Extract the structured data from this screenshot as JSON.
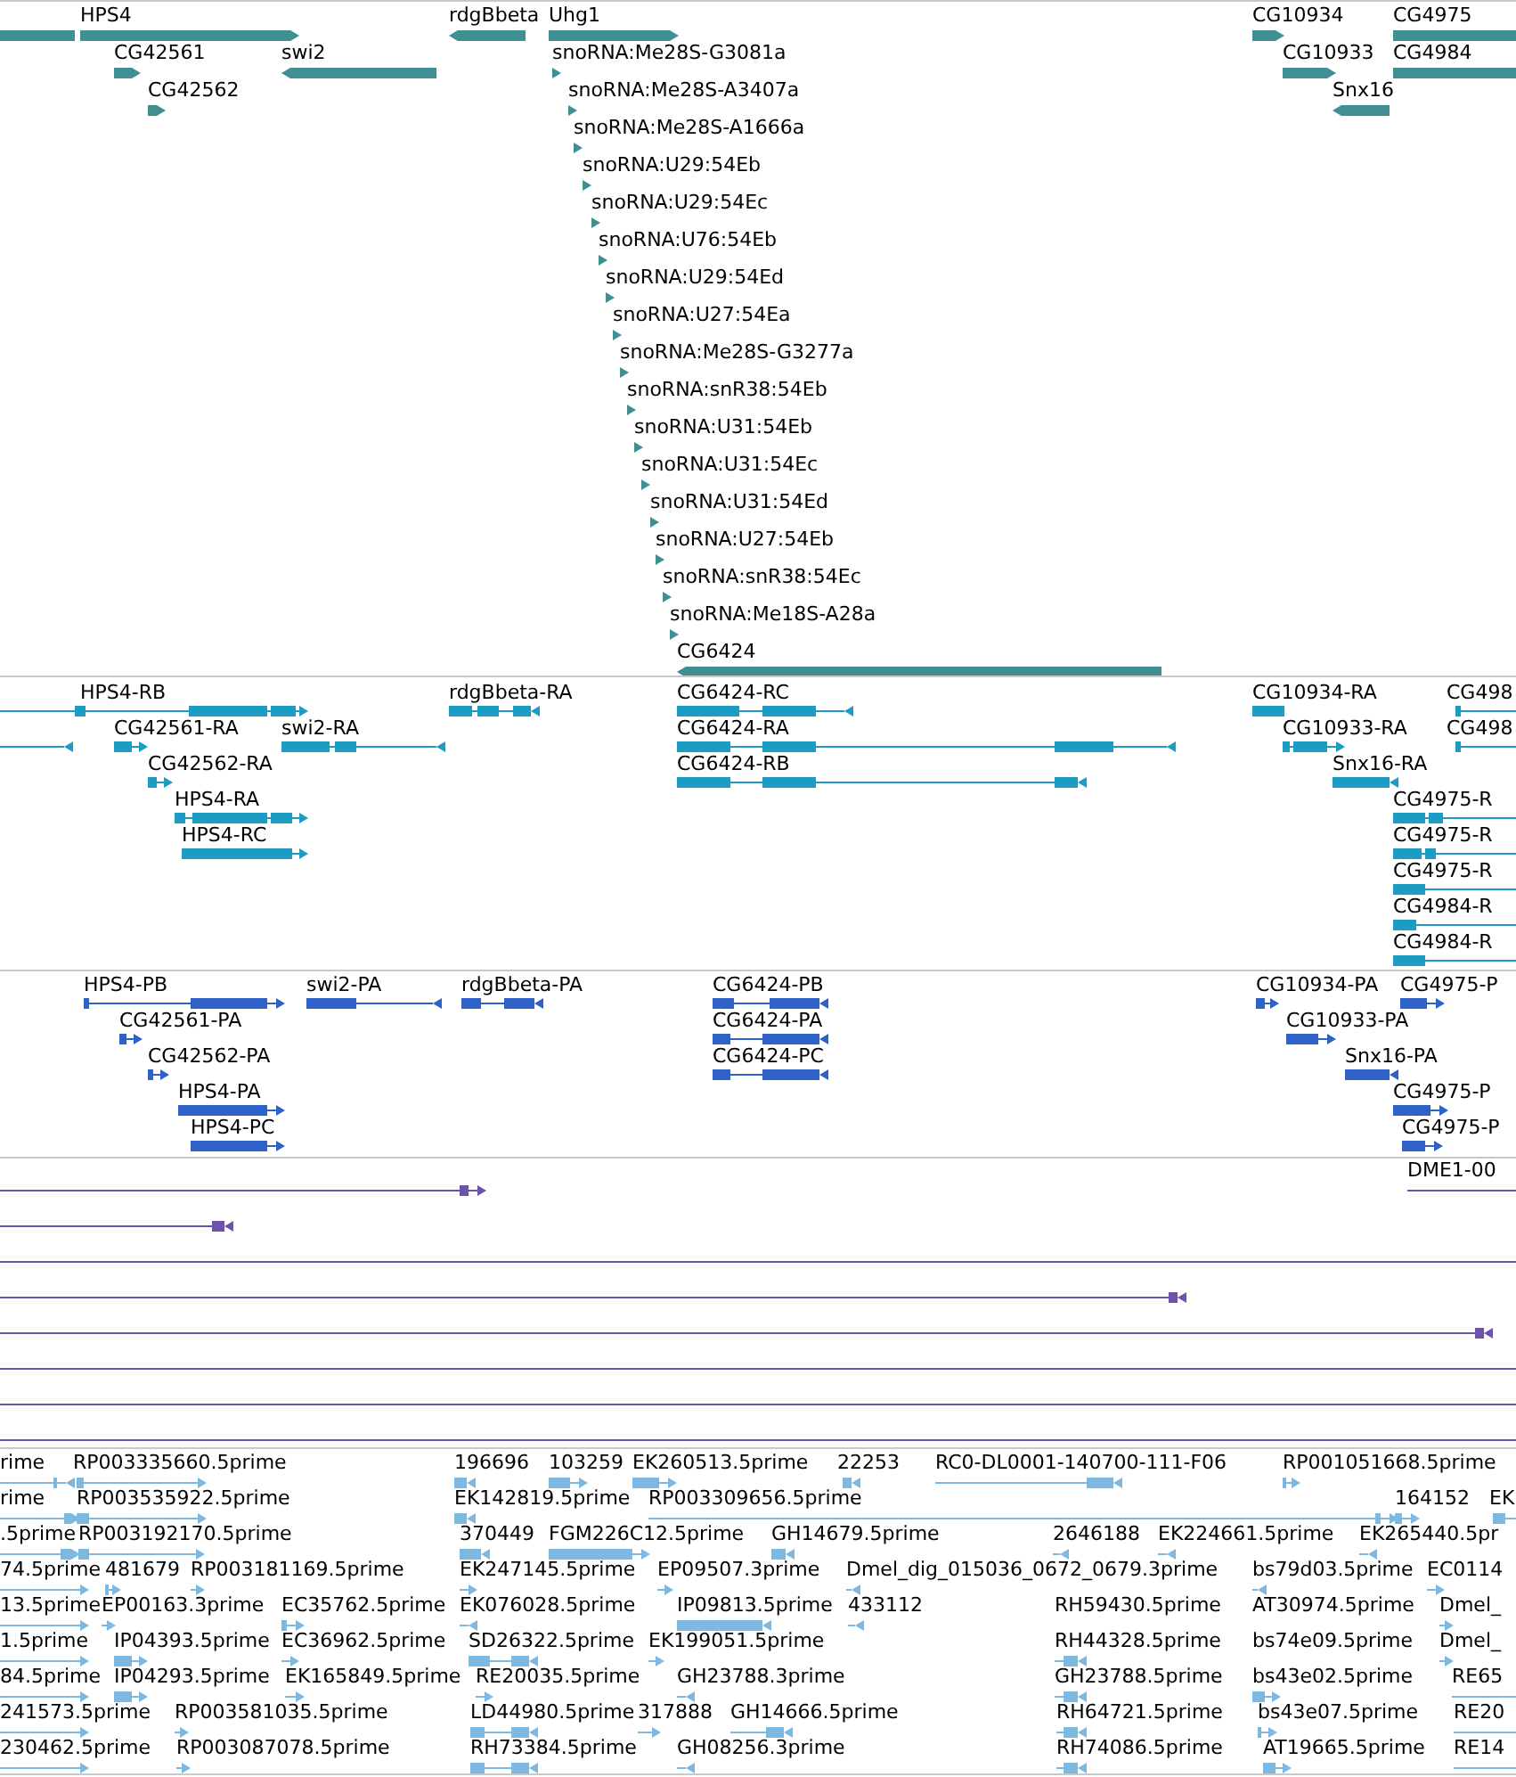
{
  "tracks": [
    {
      "kind": "genes",
      "color": "#3f8f93",
      "features": [
        {
          "kind": "open"
        },
        {
          "label": "HPS4",
          "reverse": false
        },
        {
          "label": "rdgBbeta",
          "reverse": true
        },
        {
          "label": "Uhg1",
          "reverse": false
        },
        {
          "label": "CG10934",
          "reverse": false
        },
        {
          "label": "CG4975"
        },
        {
          "label": "CG42561",
          "reverse": false
        },
        {
          "label": "swi2",
          "reverse": true
        },
        {
          "label": "snoRNA:Me28S-G3081a",
          "reverse": false
        },
        {
          "label": "CG10933",
          "reverse": false
        },
        {
          "label": "CG4984"
        },
        {
          "label": "CG42562",
          "reverse": false
        },
        {
          "label": "snoRNA:Me28S-A3407a",
          "reverse": false
        },
        {
          "label": "Snx16",
          "reverse": true
        },
        {
          "label": "snoRNA:Me28S-A1666a",
          "reverse": false
        },
        {
          "label": "snoRNA:U29:54Eb",
          "reverse": false
        },
        {
          "label": "snoRNA:U29:54Ec",
          "reverse": false
        },
        {
          "label": "snoRNA:U76:54Eb",
          "reverse": false
        },
        {
          "label": "snoRNA:U29:54Ed",
          "reverse": false
        },
        {
          "label": "snoRNA:U27:54Ea",
          "reverse": false
        },
        {
          "label": "snoRNA:Me28S-G3277a",
          "reverse": false
        },
        {
          "label": "snoRNA:snR38:54Eb",
          "reverse": false
        },
        {
          "label": "snoRNA:U31:54Eb",
          "reverse": false
        },
        {
          "label": "snoRNA:U31:54Ec",
          "reverse": false
        },
        {
          "label": "snoRNA:U31:54Ed",
          "reverse": false
        },
        {
          "label": "snoRNA:U27:54Eb",
          "reverse": false
        },
        {
          "label": "snoRNA:snR38:54Ec",
          "reverse": false
        },
        {
          "label": "snoRNA:Me18S-A28a",
          "reverse": false
        },
        {
          "label": "CG6424",
          "reverse": true
        }
      ]
    },
    {
      "kind": "transcripts",
      "color": "#1c9cc2",
      "features": [
        {
          "label": "HPS4-RB",
          "reverse": false
        },
        {
          "label": "rdgBbeta-RA",
          "reverse": true
        },
        {
          "label": "CG6424-RC",
          "reverse": true
        },
        {
          "label": "CG10934-RA"
        },
        {
          "label": "CG498"
        },
        {
          "reverse": true
        },
        {
          "label": "CG42561-RA",
          "reverse": false
        },
        {
          "label": "swi2-RA",
          "reverse": true
        },
        {
          "label": "CG6424-RA",
          "reverse": true
        },
        {
          "label": "CG10933-RA",
          "reverse": false
        },
        {
          "label": "CG498"
        },
        {
          "label": "CG42562-RA",
          "reverse": false
        },
        {
          "label": "CG6424-RB",
          "reverse": true
        },
        {
          "label": "Snx16-RA",
          "reverse": true
        },
        {
          "label": "HPS4-RA",
          "reverse": false
        },
        {
          "label": "CG4975-R"
        },
        {
          "label": "HPS4-RC",
          "reverse": false
        },
        {
          "label": "CG4975-R"
        },
        {
          "label": "CG4975-R"
        },
        {
          "label": "CG4984-R"
        },
        {
          "label": "CG4984-R"
        }
      ]
    },
    {
      "kind": "proteins",
      "color": "#2f62c9",
      "features": [
        {
          "label": "HPS4-PB",
          "reverse": false
        },
        {
          "label": "swi2-PA",
          "reverse": true
        },
        {
          "label": "rdgBbeta-PA",
          "reverse": true
        },
        {
          "label": "CG6424-PB",
          "reverse": true
        },
        {
          "label": "CG10934-PA",
          "reverse": false
        },
        {
          "label": "CG4975-P",
          "reverse": false
        },
        {
          "label": "CG42561-PA",
          "reverse": false
        },
        {
          "label": "CG6424-PA",
          "reverse": true
        },
        {
          "label": "CG10933-PA",
          "reverse": false
        },
        {
          "label": "CG42562-PA",
          "reverse": false
        },
        {
          "label": "CG6424-PC",
          "reverse": true
        },
        {
          "label": "Snx16-PA",
          "reverse": true
        },
        {
          "label": "HPS4-PA",
          "reverse": false
        },
        {
          "label": "CG4975-P",
          "reverse": false
        },
        {
          "label": "HPS4-PC",
          "reverse": false
        },
        {
          "label": "CG4975-P",
          "reverse": false
        }
      ]
    },
    {
      "kind": "alignments",
      "color": "#6c52ab",
      "features": [
        {
          "kind": "ended",
          "reverse": false
        },
        {
          "kind": "open",
          "label": "DME1-00"
        },
        {
          "kind": "ended",
          "reverse": true
        },
        {
          "kind": "open"
        },
        {
          "kind": "ended",
          "reverse": true
        },
        {
          "kind": "ended",
          "reverse": true
        },
        {
          "kind": "open"
        },
        {
          "kind": "open"
        },
        {
          "kind": "open"
        }
      ]
    },
    {
      "kind": "ests",
      "color": "#7db8e0",
      "features": [
        {
          "label": "rime",
          "reverse": true
        },
        {
          "label": "RP003335660.5prime",
          "reverse": false
        },
        {
          "label": "196696",
          "reverse": true
        },
        {
          "label": "103259",
          "reverse": false
        },
        {
          "label": "EK260513.5prime",
          "reverse": false
        },
        {
          "label": "22253",
          "reverse": true
        },
        {
          "label": "RC0-DL0001-140700-111-F06",
          "reverse": true
        },
        {
          "label": "RP001051668.5prime",
          "reverse": false
        },
        {
          "label": "rime",
          "reverse": false
        },
        {
          "label": "RP003535922.5prime",
          "reverse": false
        },
        {
          "label": "EK142819.5prime",
          "reverse": true
        },
        {
          "label": "RP003309656.5prime",
          "reverse": false
        },
        {
          "label": "164152",
          "reverse": false
        },
        {
          "label": "EK"
        },
        {
          "label": ".5prime",
          "reverse": false
        },
        {
          "label": "RP003192170.5prime",
          "reverse": false
        },
        {
          "label": "370449",
          "reverse": true
        },
        {
          "label": "FGM226C12.5prime",
          "reverse": false
        },
        {
          "label": "GH14679.5prime",
          "reverse": true
        },
        {
          "label": "2646188",
          "reverse": true
        },
        {
          "label": "EK224661.5prime",
          "reverse": true
        },
        {
          "label": "EK265440.5pr",
          "reverse": true
        },
        {
          "label": "74.5prime",
          "reverse": false
        },
        {
          "label": "481679",
          "reverse": false
        },
        {
          "label": "RP003181169.5prime",
          "reverse": false
        },
        {
          "label": "EK247145.5prime",
          "reverse": false
        },
        {
          "label": "EP09507.3prime",
          "reverse": false
        },
        {
          "label": "Dmel_dig_015036_0672_0679.3prime",
          "reverse": true
        },
        {
          "label": "bs79d03.5prime",
          "reverse": true
        },
        {
          "label": "EC0114",
          "reverse": false
        },
        {
          "label": "13.5prime",
          "reverse": false
        },
        {
          "label": "EP00163.3prime",
          "reverse": false
        },
        {
          "label": "EC35762.5prime",
          "reverse": false
        },
        {
          "label": "EK076028.5prime",
          "reverse": true
        },
        {
          "label": "IP09813.5prime",
          "reverse": true
        },
        {
          "label": "433112",
          "reverse": true
        },
        {
          "label": "RH59430.5prime"
        },
        {
          "label": "AT30974.5prime"
        },
        {
          "label": "Dmel_",
          "reverse": false
        },
        {
          "label": "1.5prime",
          "reverse": false
        },
        {
          "label": "IP04393.5prime",
          "reverse": false
        },
        {
          "label": "EC36962.5prime",
          "reverse": false
        },
        {
          "label": "SD26322.5prime",
          "reverse": true
        },
        {
          "label": "EK199051.5prime",
          "reverse": false
        },
        {
          "label": "RH44328.5prime",
          "reverse": true
        },
        {
          "label": "bs74e09.5prime"
        },
        {
          "label": "Dmel_",
          "reverse": false
        },
        {
          "label": "84.5prime",
          "reverse": false
        },
        {
          "label": "IP04293.5prime",
          "reverse": false
        },
        {
          "label": "EK165849.5prime",
          "reverse": false
        },
        {
          "label": "RE20035.5prime",
          "reverse": false
        },
        {
          "label": "GH23788.3prime",
          "reverse": true
        },
        {
          "label": "GH23788.5prime",
          "reverse": true
        },
        {
          "label": "bs43e02.5prime",
          "reverse": false
        },
        {
          "label": "RE65"
        },
        {
          "label": "241573.5prime",
          "reverse": false
        },
        {
          "label": "RP003581035.5prime",
          "reverse": false
        },
        {
          "label": "LD44980.5prime",
          "reverse": true
        },
        {
          "label": "317888",
          "reverse": false
        },
        {
          "label": "GH14666.5prime",
          "reverse": true
        },
        {
          "label": "RH64721.5prime",
          "reverse": true
        },
        {
          "label": "bs43e07.5prime",
          "reverse": false
        },
        {
          "label": "RE20"
        },
        {
          "label": "230462.5prime",
          "reverse": false
        },
        {
          "label": "RP003087078.5prime",
          "reverse": false
        },
        {
          "label": "RH73384.5prime",
          "reverse": true
        },
        {
          "label": "GH08256.3prime",
          "reverse": true
        },
        {
          "label": "RH74086.5prime",
          "reverse": true
        },
        {
          "label": "AT19665.5prime",
          "reverse": false
        },
        {
          "label": "RE14"
        }
      ]
    }
  ]
}
